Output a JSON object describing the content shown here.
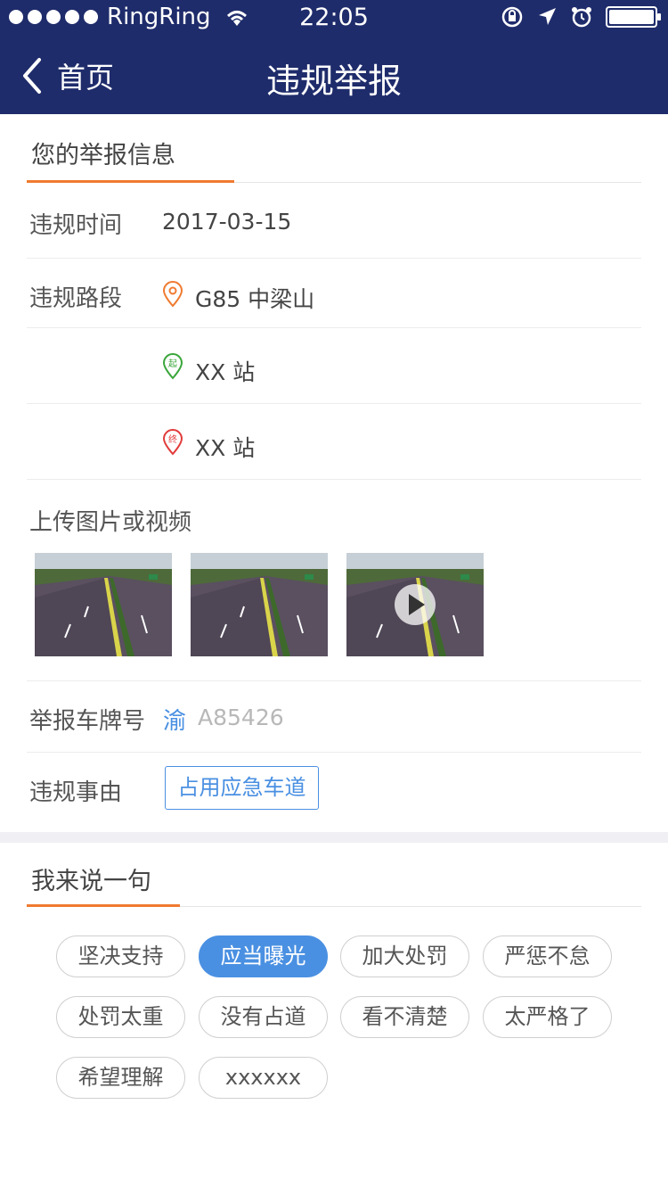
{
  "status_bar": {
    "carrier": "RingRing",
    "time": "22:05"
  },
  "nav": {
    "back_label": "首页",
    "title": "违规举报"
  },
  "report_info": {
    "section_title": "您的举报信息",
    "time_label": "违规时间",
    "time_value": "2017-03-15",
    "road_label": "违规路段",
    "road_value": "G85 中梁山",
    "start_marker": "起",
    "start_value": "XX 站",
    "end_marker": "终",
    "end_value": "XX 站",
    "upload_title": "上传图片或视频",
    "media": [
      {
        "type": "image",
        "name": "highway-photo"
      },
      {
        "type": "image",
        "name": "highway-photo"
      },
      {
        "type": "video",
        "name": "highway-video"
      }
    ],
    "plate_label": "举报车牌号",
    "plate_prefix": "渝",
    "plate_number": "A85426",
    "reason_label": "违规事由",
    "reason_tag": "占用应急车道"
  },
  "comment": {
    "section_title": "我来说一句",
    "chips": [
      {
        "label": "坚决支持",
        "selected": false
      },
      {
        "label": "应当曝光",
        "selected": true
      },
      {
        "label": "加大处罚",
        "selected": false
      },
      {
        "label": "严惩不怠",
        "selected": false
      },
      {
        "label": "处罚太重",
        "selected": false
      },
      {
        "label": "没有占道",
        "selected": false
      },
      {
        "label": "看不清楚",
        "selected": false
      },
      {
        "label": "太严格了",
        "selected": false
      },
      {
        "label": "希望理解",
        "selected": false
      },
      {
        "label": "xxxxxx",
        "selected": false
      }
    ]
  },
  "colors": {
    "nav_bg": "#1f2c6b",
    "accent_orange": "#f07a30",
    "accent_blue": "#4a90e2",
    "start_green": "#3aa63a",
    "end_red": "#e23b3b"
  }
}
